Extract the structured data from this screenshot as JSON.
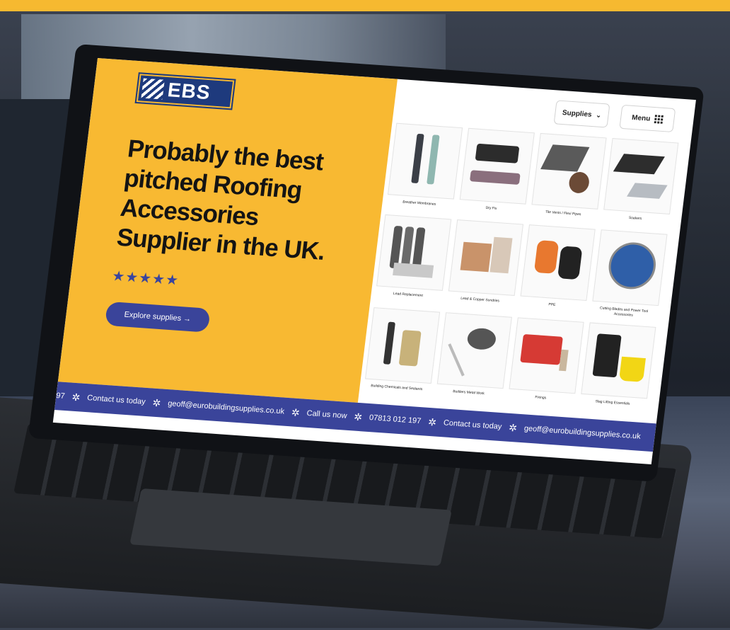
{
  "page": {
    "logo_text": "EBS",
    "headline": "Probably the best pitched Roofing Accessories Supplier in the UK.",
    "rating_stars": "★★★★★",
    "rating_value": 5,
    "cta_label": "Explore supplies →"
  },
  "nav": {
    "supplies_label": "Supplies",
    "supplies_icon": "chevron-down-icon",
    "menu_label": "Menu",
    "menu_icon": "grid-icon"
  },
  "products": [
    {
      "label": "Breather Membranes"
    },
    {
      "label": "Dry Fix"
    },
    {
      "label": "Tile Vents / Flexi Pipes"
    },
    {
      "label": "Soakers"
    },
    {
      "label": "Lead Replacement"
    },
    {
      "label": "Lead & Copper Sundries"
    },
    {
      "label": "PPE"
    },
    {
      "label": "Cutting Blades and Power Tool Accessories"
    },
    {
      "label": "Building Chemicals and Sealants"
    },
    {
      "label": "Builders Metal Work"
    },
    {
      "label": "Fixings"
    },
    {
      "label": "Slag Lifting Essentials"
    }
  ],
  "ticker": {
    "items": [
      "97",
      "Contact us today",
      "geoff@eurobuildingsupplies.co.uk",
      "Call us now",
      "07813 012 197",
      "Contact us today",
      "geoff@eurobuildingsupplies.co.uk"
    ],
    "separator": "✲"
  },
  "colors": {
    "brand_yellow": "#f8b932",
    "brand_blue": "#3a449a"
  }
}
